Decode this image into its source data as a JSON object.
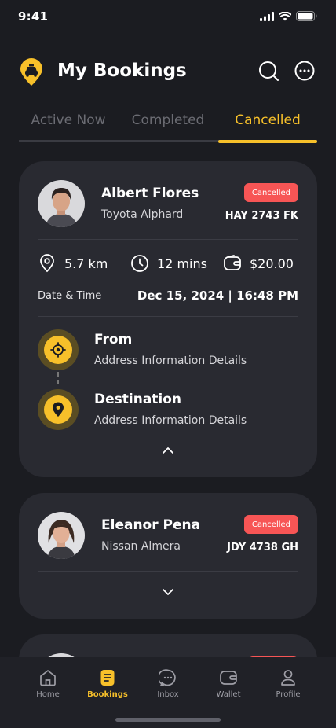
{
  "status_bar": {
    "time": "9:41"
  },
  "header": {
    "title": "My Bookings"
  },
  "tabs": [
    {
      "label": "Active Now",
      "active": false
    },
    {
      "label": "Completed",
      "active": false
    },
    {
      "label": "Cancelled",
      "active": true
    }
  ],
  "bookings": [
    {
      "driver_name": "Albert Flores",
      "car_model": "Toyota Alphard",
      "status": "Cancelled",
      "plate": "HAY 2743 FK",
      "distance": "5.7 km",
      "duration": "12 mins",
      "price": "$20.00",
      "datetime_label": "Date & Time",
      "datetime_value": "Dec 15, 2024 | 16:48 PM",
      "from_title": "From",
      "from_address": "Address Information Details",
      "dest_title": "Destination",
      "dest_address": "Address Information Details",
      "expanded": true
    },
    {
      "driver_name": "Eleanor Pena",
      "car_model": "Nissan Almera",
      "status": "Cancelled",
      "plate": "JDY 4738 GH",
      "expanded": false
    }
  ],
  "nav": [
    {
      "label": "Home",
      "icon": "home-icon",
      "active": false
    },
    {
      "label": "Bookings",
      "icon": "bookings-icon",
      "active": true
    },
    {
      "label": "Inbox",
      "icon": "inbox-icon",
      "active": false
    },
    {
      "label": "Wallet",
      "icon": "wallet-icon",
      "active": false
    },
    {
      "label": "Profile",
      "icon": "profile-icon",
      "active": false
    }
  ],
  "colors": {
    "accent": "#f7c02a",
    "badge": "#f75555",
    "background": "#1b1c21",
    "card": "#292a31"
  }
}
